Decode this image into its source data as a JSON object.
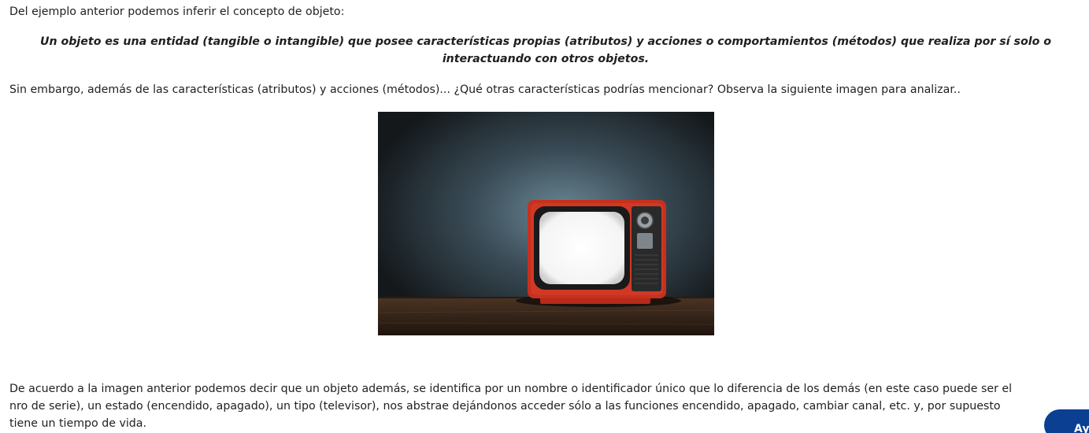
{
  "content": {
    "intro": "Del ejemplo anterior podemos inferir el concepto de objeto:",
    "definition_line1": "Un objeto es una entidad (tangible o intangible) que posee características propias (atributos) y acciones o comportamientos (métodos) que realiza por sí solo o",
    "definition_line2": "interactuando con otros objetos.",
    "question": "Sin embargo, además de las características (atributos) y acciones (métodos)... ¿Qué otras características podrías mencionar? Observa la siguiente imagen para analizar..",
    "conclusion_line1": "De acuerdo a la imagen anterior podemos decir que un objeto además, se  identifica por un nombre o identificador único que lo diferencia de los demás (en este caso puede ser el",
    "conclusion_line2": "nro de serie), un estado (encendido, apagado), un tipo (televisor), nos abstrae dejándonos acceder sólo a las funciones encendido, apagado, cambiar canal, etc. y, por supuesto",
    "conclusion_line3": "tiene un tiempo de vida."
  },
  "figure": {
    "subject": "retro-red-television-photo"
  },
  "help_button": {
    "label": "Ayu"
  },
  "colors": {
    "help_button_bg": "#0a3f91",
    "tv_red": "#c8301e",
    "wall": "#2f3c45"
  }
}
